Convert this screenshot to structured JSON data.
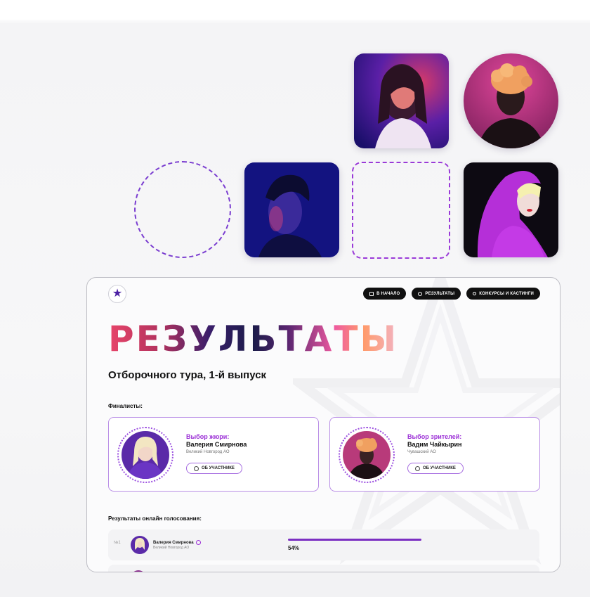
{
  "icons": {
    "logo": "star-icon",
    "nav_home": "home-icon",
    "nav_results": "person-icon",
    "nav_contests": "music-note-icon",
    "about": "info-icon"
  },
  "colors": {
    "accent": "#7b2fc2",
    "accent_text": "#9b2fd6",
    "nav_bg": "#111111"
  },
  "site": {
    "logo": "★",
    "nav": [
      {
        "label": "В НАЧАЛО"
      },
      {
        "label": "РЕЗУЛЬТАТЫ"
      },
      {
        "label": "КОНКУРСЫ И КАСТИНГИ"
      }
    ],
    "title": "РЕЗУЛЬТАТЫ",
    "subtitle": "Отборочного тура, 1-й выпуск",
    "finalists_label": "Финалисты:",
    "finalists": [
      {
        "kind": "Выбор жюри:",
        "name": "Валерия Смирнова",
        "city": "Великий Новгород АО",
        "button": "ОБ УЧАСТНИКЕ"
      },
      {
        "kind": "Выбор зрителей:",
        "name": "Вадим Чайкырин",
        "city": "Чувашский АО",
        "button": "ОБ УЧАСТНИКЕ"
      }
    ],
    "voting_label": "Результаты онлайн голосования:",
    "votes": [
      {
        "rank": "№1",
        "name": "Валерия Смирнова",
        "city": "Великий Новгород АО",
        "percent": "54%",
        "share": 0.54
      }
    ]
  }
}
